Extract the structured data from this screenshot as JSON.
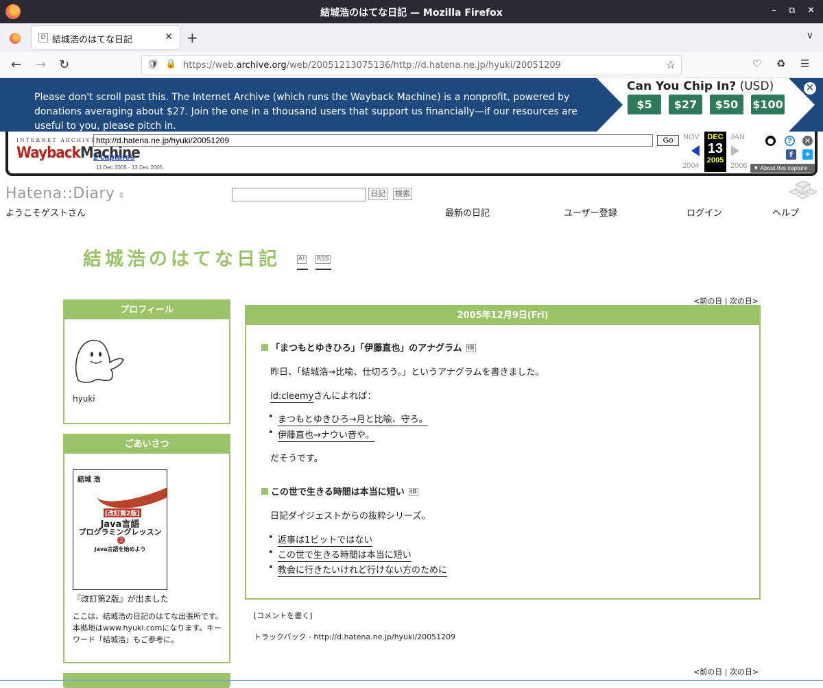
{
  "window": {
    "title": "結城浩のはてな日記 — Mozilla Firefox"
  },
  "tabs": [
    {
      "label": "結城浩のはてな日記",
      "favicon": "D"
    }
  ],
  "urlbar": {
    "url_prefix": "https://web.",
    "url_domain": "archive.org",
    "url_suffix": "/web/20051213075136/http://d.hatena.ne.jp/hyuki/20051209"
  },
  "donation": {
    "message": "Please don't scroll past this. The Internet Archive (which runs the Wayback Machine) is a nonprofit, powered by donations averaging about $27. Join the one in a thousand users that support us financially—if our resources are useful to you, please pitch in.",
    "heading": "Can You Chip In?",
    "currency": "(USD)",
    "amounts": [
      "$5",
      "$27",
      "$50",
      "$100"
    ],
    "bg_color": "#1e4a7f",
    "button_color": "#2f7a59"
  },
  "wayback": {
    "logo_top": "INTERNET ARCHIVE",
    "logo_main_a": "Wayback",
    "logo_main_b": "Machine",
    "url": "http://d.hatena.ne.jp/hyuki/20051209",
    "go": "Go",
    "captures": "2 captures",
    "range": "11 Dec 2005 - 13 Dec 2005",
    "prev_month": "NOV",
    "cur_month": "DEC",
    "next_month": "JAN",
    "cur_day": "13",
    "prev_year": "2004",
    "cur_year": "2005",
    "next_year": "2006",
    "about": "About this capture"
  },
  "hatena": {
    "logo": "Hatena::Diary",
    "search_buttons": [
      "日記",
      "検索"
    ],
    "greeting": "ようこそゲストさん",
    "nav": [
      "最新の日記",
      "ユーザー登録",
      "ログイン",
      "ヘルプ"
    ],
    "diary_title": "結城浩のはてな日記",
    "title_buttons": [
      "A!",
      "RSS"
    ],
    "accent": "#9bc468"
  },
  "sidebar": {
    "profile_header": "プロフィール",
    "username": "hyuki",
    "greeting_header": "ごあいさつ",
    "book": {
      "author": "結城 浩",
      "edition": "[改訂第2版]",
      "title_line1": "Java言語",
      "title_line2": "プログラミングレッスン",
      "volume": "上",
      "subtitle": "Java言語を始めよう"
    },
    "book_caption": "『改訂第2版』が出ました",
    "text": "ここは、結城浩の日記のはてな出張所です。本拠地はwww.hyuki.comになります。キーワード「結城浩」もご参考に。"
  },
  "entry": {
    "nav_prev": "<前の日",
    "nav_sep": "|",
    "nav_next": "次の日>",
    "date": "2005年12月9日(Fri)",
    "section1": {
      "title": "「まつもとゆきひろ」「伊藤直也」のアナグラム",
      "badge": "B",
      "p1": "昨日、「結城浩→比喩、仕切ろう。」というアナグラムを書きました。",
      "p2_link": "id:cleemy",
      "p2_rest": "さんによれば：",
      "items": [
        "まつもとゆきひろ→月と比喩、守ろ。",
        "伊藤直也→ナウい音や。"
      ],
      "p3": "だそうです。"
    },
    "section2": {
      "title": "この世で生きる時間は本当に短い",
      "badge": "B",
      "p1": "日記ダイジェストからの抜粋シリーズ。",
      "items": [
        "返事は1ビットではない",
        "この世で生きる時間は本当に短い",
        "教会に行きたいけれど行けない方のために"
      ]
    },
    "comment": "[コメントを書く]",
    "trackback": "トラックバック - http://d.hatena.ne.jp/hyuki/20051209"
  }
}
